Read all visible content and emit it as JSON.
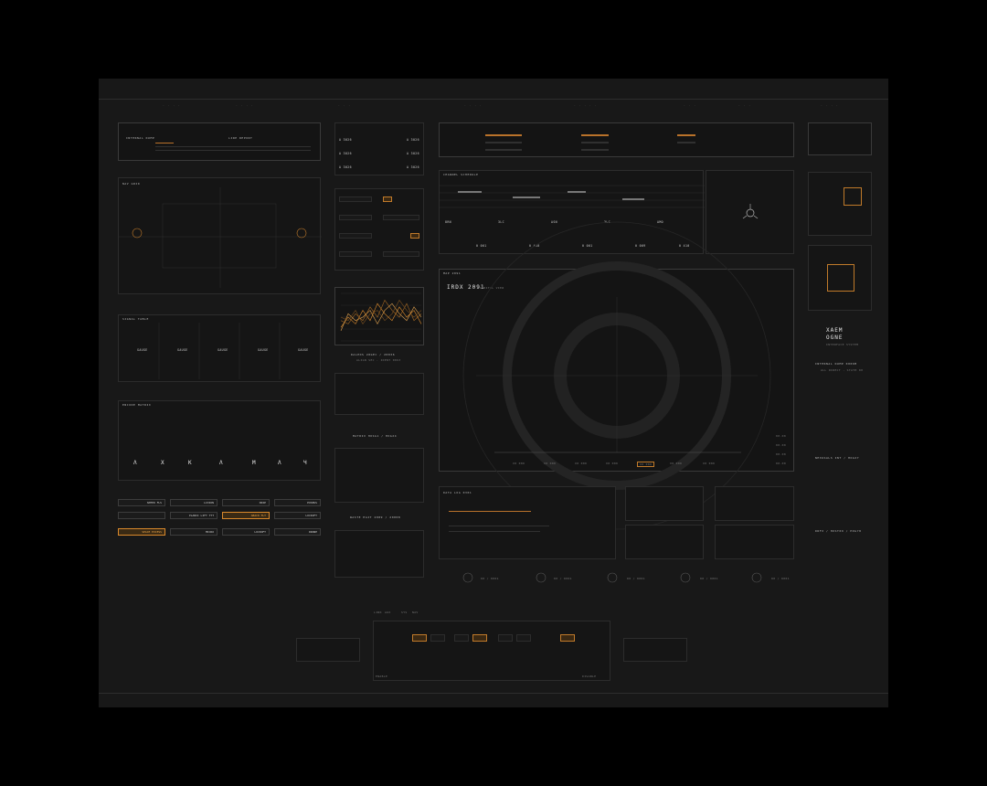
{
  "brand": {
    "logo_line1": "XAEM",
    "logo_line2": "OGNE",
    "tagline": "INTERFACE SYSTEM"
  },
  "top_ticks": [
    "· · · ·",
    "· · · ·",
    "· · ·",
    "· · · ·",
    "· · · · ·",
    "· · ·",
    "· · ·",
    "· · · ·"
  ],
  "left": {
    "header_panel": {
      "title_a": "INTERNAL DUMP",
      "title_b": "LINE REPORT"
    },
    "nav_section": {
      "title": "NAV GRID"
    },
    "grid_section": {
      "title": "SIGNAL TABLE",
      "columns": [
        "GAUGE",
        "GAUGE",
        "GAUGE",
        "GAUGE",
        "GAUGE"
      ]
    },
    "glyph_section": {
      "title": "ENCODE MATRIX",
      "glyphs": [
        "Λ",
        "X",
        "K",
        "Λ",
        "Μ",
        "Λ",
        "Ч"
      ]
    },
    "buttons": [
      {
        "label": "SPEED FLS",
        "active": false
      },
      {
        "label": "LIXION",
        "active": false
      },
      {
        "label": "DRIP",
        "active": false
      },
      {
        "label": "POSEUS",
        "active": false
      },
      {
        "label": "",
        "active": false
      },
      {
        "label": "PLANIC LIFT TTT",
        "active": false
      },
      {
        "label": "ABACK FLT",
        "active": true
      },
      {
        "label": "LOCKOFT",
        "active": false
      },
      {
        "label": "SPACE EXCESS",
        "active": true
      },
      {
        "label": "MICRO",
        "active": false
      },
      {
        "label": "LOCKOFT",
        "active": false
      },
      {
        "label": "DRONE",
        "active": false
      }
    ]
  },
  "mid": {
    "grid_labels": [
      "A 3026",
      "A 3026",
      "A 3026",
      "A 3026",
      "A 3026",
      "A 3026"
    ],
    "chart_title": "DALPOS 20GEC / 20036",
    "chart_sub": "ALIGN SEC · IDENT 0063",
    "matrix_title": "MATRIX HOSG1 / HOG24",
    "waste_title": "WASTE HAIT 2089 / 20008"
  },
  "center": {
    "timeline_title": "CHANNEL SCHEDULE",
    "cards": [
      {
        "code": "8RN",
        "value": "0 001"
      },
      {
        "code": "3LC",
        "value": "0 410"
      },
      {
        "code": "ASN",
        "value": "0 001"
      },
      {
        "code": "3LC",
        "value": "0 009"
      },
      {
        "code": "AMO",
        "value": "0 410"
      }
    ],
    "main_title": "IRDX 2091",
    "main_sub": "ORBITAL VIEW",
    "main_top": "MAP 2091",
    "scale_labels": [
      "X0 000",
      "X0 000",
      "X0 000",
      "X0 000",
      "X0 000",
      "X0 000",
      "X0 000"
    ],
    "scale_active": 4,
    "status_items": [
      "00.00",
      "00.00",
      "00.00",
      "00.00"
    ],
    "log_title": "DATA LOG 0301",
    "dials": [
      "00 / 0001",
      "00 / 0001",
      "00 / 0001",
      "00 / 0001",
      "00 / 0001"
    ]
  },
  "right": {
    "internal_dump": "INTERNAL DUMP 0006M",
    "internal_sub": "ALL DIRECT · STATE 00",
    "section2": "NEXUSALS INT / HOG27",
    "section3": "DRFX / HOST09 / HOG78"
  },
  "bottom": {
    "tab_labels": [
      "LINK",
      "AUX",
      "SYS",
      "NAV"
    ],
    "footer_left": "ENABLE",
    "footer_right": "DISABLE"
  },
  "colors": {
    "accent": "#d9892c",
    "background": "#181818",
    "frame": "#000000"
  },
  "chart_data": {
    "type": "line",
    "title": "DALPOS 20GEC / 20036",
    "x": [
      0,
      1,
      2,
      3,
      4,
      5,
      6,
      7,
      8,
      9,
      10,
      11
    ],
    "series": [
      {
        "values": [
          4,
          7,
          5,
          9,
          6,
          11,
          8,
          6,
          10,
          7,
          9,
          5
        ]
      },
      {
        "values": [
          6,
          5,
          8,
          6,
          10,
          7,
          12,
          9,
          7,
          11,
          6,
          8
        ]
      },
      {
        "values": [
          3,
          8,
          6,
          7,
          9,
          5,
          9,
          11,
          8,
          6,
          10,
          7
        ]
      },
      {
        "values": [
          7,
          6,
          9,
          5,
          8,
          9,
          6,
          8,
          12,
          9,
          7,
          9
        ]
      }
    ],
    "ylim": [
      0,
      14
    ],
    "grid": true
  }
}
